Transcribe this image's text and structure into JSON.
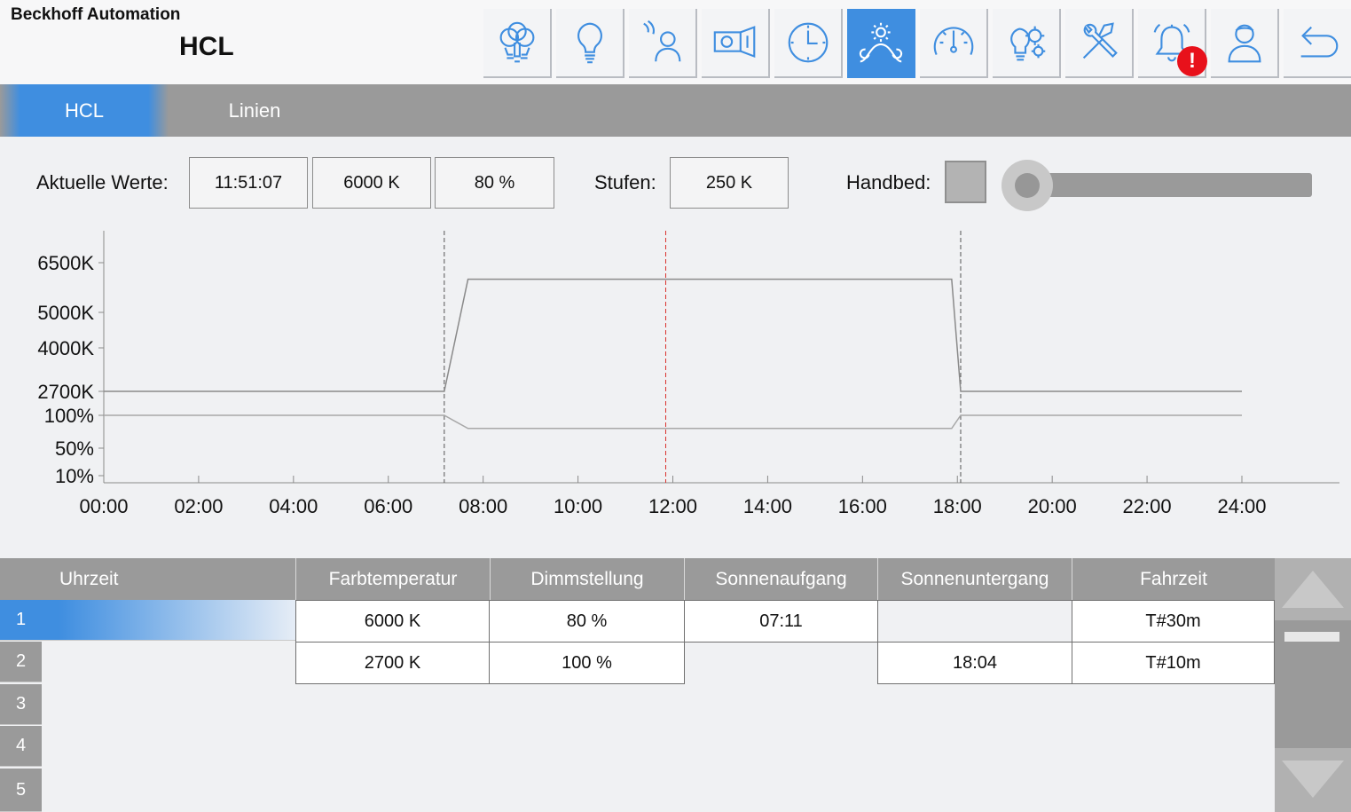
{
  "header": {
    "company": "Beckhoff Automation",
    "title": "HCL",
    "nav": [
      {
        "name": "lights-group-icon",
        "active": false
      },
      {
        "name": "bulb-icon",
        "active": false
      },
      {
        "name": "presence-person-icon",
        "active": false
      },
      {
        "name": "projector-icon",
        "active": false
      },
      {
        "name": "clock-icon",
        "active": false
      },
      {
        "name": "daylight-curve-icon",
        "active": true
      },
      {
        "name": "gauge-icon",
        "active": false
      },
      {
        "name": "gears-bulb-icon",
        "active": false
      },
      {
        "name": "tools-icon",
        "active": false
      },
      {
        "name": "alarm-bell-icon",
        "active": false,
        "alert": "!"
      },
      {
        "name": "user-icon",
        "active": false
      },
      {
        "name": "back-arrow-icon",
        "active": false
      }
    ],
    "accent": "#3f8ee0",
    "alert_color": "#e8111b"
  },
  "tabs": [
    {
      "label": "HCL",
      "active": true
    },
    {
      "label": "Linien",
      "active": false
    }
  ],
  "values": {
    "current_label": "Aktuelle Werte:",
    "time": "11:51:07",
    "color_temp": "6000 K",
    "dimming": "80 %",
    "steps_label": "Stufen:",
    "steps": "250 K",
    "manual_label": "Handbed:",
    "manual_checked": false,
    "slider_value": 0
  },
  "chart_data": {
    "type": "line",
    "x_unit": "hours",
    "x_range": [
      0,
      24
    ],
    "x_ticks": [
      "00:00",
      "02:00",
      "04:00",
      "06:00",
      "08:00",
      "10:00",
      "12:00",
      "14:00",
      "16:00",
      "18:00",
      "20:00",
      "22:00",
      "24:00"
    ],
    "y_ticks_temp": [
      "6500K",
      "5000K",
      "4000K",
      "2700K"
    ],
    "y_ticks_dim": [
      "100%",
      "50%",
      "10%"
    ],
    "series": [
      {
        "x": [
          0,
          7.18,
          7.68,
          17.88,
          18.07,
          24
        ],
        "values": [
          2700,
          2700,
          6000,
          6000,
          2700,
          2700
        ],
        "color": "#8a8a8a"
      },
      {
        "x": [
          0,
          7.18,
          7.68,
          17.88,
          18.07,
          24
        ],
        "values": [
          100,
          100,
          80,
          80,
          100,
          100
        ],
        "color": "#a8a8a8"
      }
    ],
    "markers": [
      {
        "x": 7.18,
        "style": "dashed",
        "color": "#555555"
      },
      {
        "x": 18.07,
        "style": "dashed",
        "color": "#555555"
      },
      {
        "x": 11.85,
        "style": "dashed",
        "color": "#d9302c"
      }
    ],
    "grid": false
  },
  "table": {
    "columns": [
      "Uhrzeit",
      "Farbtemperatur",
      "Dimmstellung",
      "Sonnenaufgang",
      "Sonnenuntergang",
      "Fahrzeit"
    ],
    "row_numbers": [
      "1",
      "2",
      "3",
      "4",
      "5"
    ],
    "rows": [
      [
        "",
        "6000 K",
        "80 %",
        "07:11",
        "",
        "T#30m"
      ],
      [
        "",
        "2700 K",
        "100 %",
        "",
        "18:04",
        "T#10m"
      ]
    ]
  }
}
